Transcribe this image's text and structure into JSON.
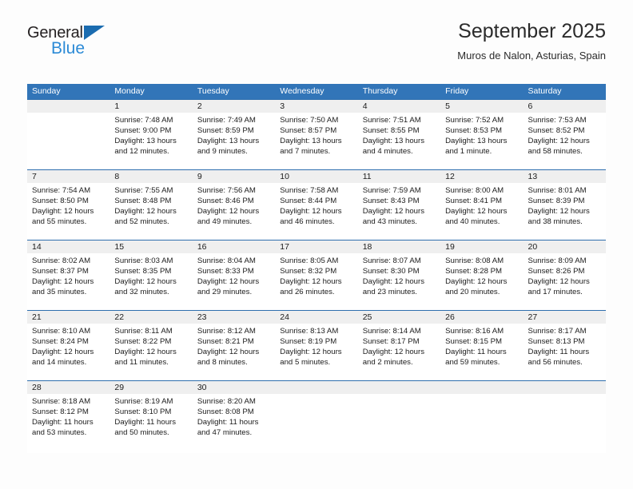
{
  "logo": {
    "text_primary": "General",
    "text_secondary": "Blue",
    "triangle_color": "#1b6cb0",
    "secondary_color": "#2b8ad6"
  },
  "header": {
    "title": "September 2025",
    "subtitle": "Muros de Nalon, Asturias, Spain"
  },
  "theme": {
    "header_bg": "#3275b8",
    "header_text": "#ffffff",
    "row_divider": "#2f6fae",
    "daynum_bg": "#efefef",
    "cell_bg": "#ffffff",
    "text": "#1c1c1c"
  },
  "weekdays": [
    "Sunday",
    "Monday",
    "Tuesday",
    "Wednesday",
    "Thursday",
    "Friday",
    "Saturday"
  ],
  "labels": {
    "sunrise": "Sunrise:",
    "sunset": "Sunset:",
    "daylight": "Daylight:"
  },
  "weeks": [
    {
      "numbers": [
        "",
        "1",
        "2",
        "3",
        "4",
        "5",
        "6"
      ],
      "cells": [
        {
          "empty": true
        },
        {
          "sunrise": "Sunrise: 7:48 AM",
          "sunset": "Sunset: 9:00 PM",
          "daylight": "Daylight: 13 hours and 12 minutes."
        },
        {
          "sunrise": "Sunrise: 7:49 AM",
          "sunset": "Sunset: 8:59 PM",
          "daylight": "Daylight: 13 hours and 9 minutes."
        },
        {
          "sunrise": "Sunrise: 7:50 AM",
          "sunset": "Sunset: 8:57 PM",
          "daylight": "Daylight: 13 hours and 7 minutes."
        },
        {
          "sunrise": "Sunrise: 7:51 AM",
          "sunset": "Sunset: 8:55 PM",
          "daylight": "Daylight: 13 hours and 4 minutes."
        },
        {
          "sunrise": "Sunrise: 7:52 AM",
          "sunset": "Sunset: 8:53 PM",
          "daylight": "Daylight: 13 hours and 1 minute."
        },
        {
          "sunrise": "Sunrise: 7:53 AM",
          "sunset": "Sunset: 8:52 PM",
          "daylight": "Daylight: 12 hours and 58 minutes."
        }
      ]
    },
    {
      "numbers": [
        "7",
        "8",
        "9",
        "10",
        "11",
        "12",
        "13"
      ],
      "cells": [
        {
          "sunrise": "Sunrise: 7:54 AM",
          "sunset": "Sunset: 8:50 PM",
          "daylight": "Daylight: 12 hours and 55 minutes."
        },
        {
          "sunrise": "Sunrise: 7:55 AM",
          "sunset": "Sunset: 8:48 PM",
          "daylight": "Daylight: 12 hours and 52 minutes."
        },
        {
          "sunrise": "Sunrise: 7:56 AM",
          "sunset": "Sunset: 8:46 PM",
          "daylight": "Daylight: 12 hours and 49 minutes."
        },
        {
          "sunrise": "Sunrise: 7:58 AM",
          "sunset": "Sunset: 8:44 PM",
          "daylight": "Daylight: 12 hours and 46 minutes."
        },
        {
          "sunrise": "Sunrise: 7:59 AM",
          "sunset": "Sunset: 8:43 PM",
          "daylight": "Daylight: 12 hours and 43 minutes."
        },
        {
          "sunrise": "Sunrise: 8:00 AM",
          "sunset": "Sunset: 8:41 PM",
          "daylight": "Daylight: 12 hours and 40 minutes."
        },
        {
          "sunrise": "Sunrise: 8:01 AM",
          "sunset": "Sunset: 8:39 PM",
          "daylight": "Daylight: 12 hours and 38 minutes."
        }
      ]
    },
    {
      "numbers": [
        "14",
        "15",
        "16",
        "17",
        "18",
        "19",
        "20"
      ],
      "cells": [
        {
          "sunrise": "Sunrise: 8:02 AM",
          "sunset": "Sunset: 8:37 PM",
          "daylight": "Daylight: 12 hours and 35 minutes."
        },
        {
          "sunrise": "Sunrise: 8:03 AM",
          "sunset": "Sunset: 8:35 PM",
          "daylight": "Daylight: 12 hours and 32 minutes."
        },
        {
          "sunrise": "Sunrise: 8:04 AM",
          "sunset": "Sunset: 8:33 PM",
          "daylight": "Daylight: 12 hours and 29 minutes."
        },
        {
          "sunrise": "Sunrise: 8:05 AM",
          "sunset": "Sunset: 8:32 PM",
          "daylight": "Daylight: 12 hours and 26 minutes."
        },
        {
          "sunrise": "Sunrise: 8:07 AM",
          "sunset": "Sunset: 8:30 PM",
          "daylight": "Daylight: 12 hours and 23 minutes."
        },
        {
          "sunrise": "Sunrise: 8:08 AM",
          "sunset": "Sunset: 8:28 PM",
          "daylight": "Daylight: 12 hours and 20 minutes."
        },
        {
          "sunrise": "Sunrise: 8:09 AM",
          "sunset": "Sunset: 8:26 PM",
          "daylight": "Daylight: 12 hours and 17 minutes."
        }
      ]
    },
    {
      "numbers": [
        "21",
        "22",
        "23",
        "24",
        "25",
        "26",
        "27"
      ],
      "cells": [
        {
          "sunrise": "Sunrise: 8:10 AM",
          "sunset": "Sunset: 8:24 PM",
          "daylight": "Daylight: 12 hours and 14 minutes."
        },
        {
          "sunrise": "Sunrise: 8:11 AM",
          "sunset": "Sunset: 8:22 PM",
          "daylight": "Daylight: 12 hours and 11 minutes."
        },
        {
          "sunrise": "Sunrise: 8:12 AM",
          "sunset": "Sunset: 8:21 PM",
          "daylight": "Daylight: 12 hours and 8 minutes."
        },
        {
          "sunrise": "Sunrise: 8:13 AM",
          "sunset": "Sunset: 8:19 PM",
          "daylight": "Daylight: 12 hours and 5 minutes."
        },
        {
          "sunrise": "Sunrise: 8:14 AM",
          "sunset": "Sunset: 8:17 PM",
          "daylight": "Daylight: 12 hours and 2 minutes."
        },
        {
          "sunrise": "Sunrise: 8:16 AM",
          "sunset": "Sunset: 8:15 PM",
          "daylight": "Daylight: 11 hours and 59 minutes."
        },
        {
          "sunrise": "Sunrise: 8:17 AM",
          "sunset": "Sunset: 8:13 PM",
          "daylight": "Daylight: 11 hours and 56 minutes."
        }
      ]
    },
    {
      "numbers": [
        "28",
        "29",
        "30",
        "",
        "",
        "",
        ""
      ],
      "cells": [
        {
          "sunrise": "Sunrise: 8:18 AM",
          "sunset": "Sunset: 8:12 PM",
          "daylight": "Daylight: 11 hours and 53 minutes."
        },
        {
          "sunrise": "Sunrise: 8:19 AM",
          "sunset": "Sunset: 8:10 PM",
          "daylight": "Daylight: 11 hours and 50 minutes."
        },
        {
          "sunrise": "Sunrise: 8:20 AM",
          "sunset": "Sunset: 8:08 PM",
          "daylight": "Daylight: 11 hours and 47 minutes."
        },
        {
          "empty": true
        },
        {
          "empty": true
        },
        {
          "empty": true
        },
        {
          "empty": true
        }
      ]
    }
  ]
}
